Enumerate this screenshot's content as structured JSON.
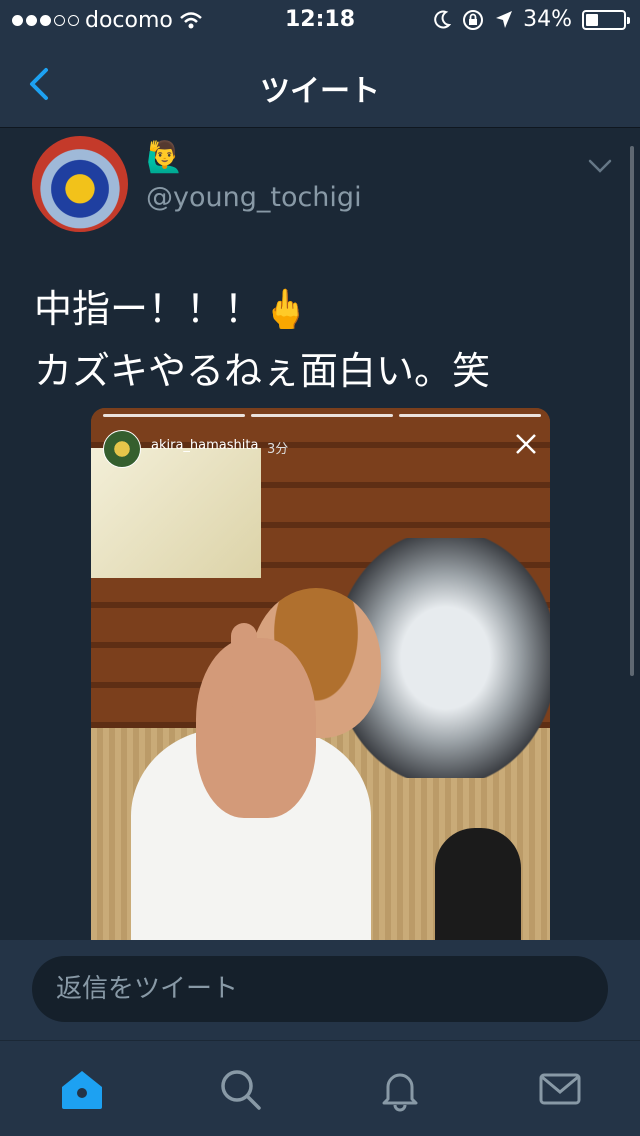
{
  "status_bar": {
    "carrier": "docomo",
    "time": "12:18",
    "battery": "34%",
    "battery_level": 0.34
  },
  "nav": {
    "title": "ツイート",
    "back_icon": "chevron-left-icon"
  },
  "tweet": {
    "emoji": "🙋‍♂️",
    "handle": "@young_tochigi",
    "text_lines": [
      "中指ー！！！🖕",
      "カズキやるねぇ面白い。笑"
    ],
    "media": {
      "story_user": "akira_hamashita",
      "story_time": "3分",
      "story_segments": 3
    }
  },
  "reply": {
    "placeholder": "返信をツイート"
  },
  "tabs": [
    {
      "name": "home",
      "icon": "home-icon",
      "active": true
    },
    {
      "name": "search",
      "icon": "search-icon",
      "active": false
    },
    {
      "name": "notifications",
      "icon": "bell-icon",
      "active": false
    },
    {
      "name": "messages",
      "icon": "envelope-icon",
      "active": false
    }
  ],
  "colors": {
    "accent": "#1da1f2",
    "background": "#1b2836",
    "bar": "#243447",
    "muted_text": "#8899a6"
  }
}
